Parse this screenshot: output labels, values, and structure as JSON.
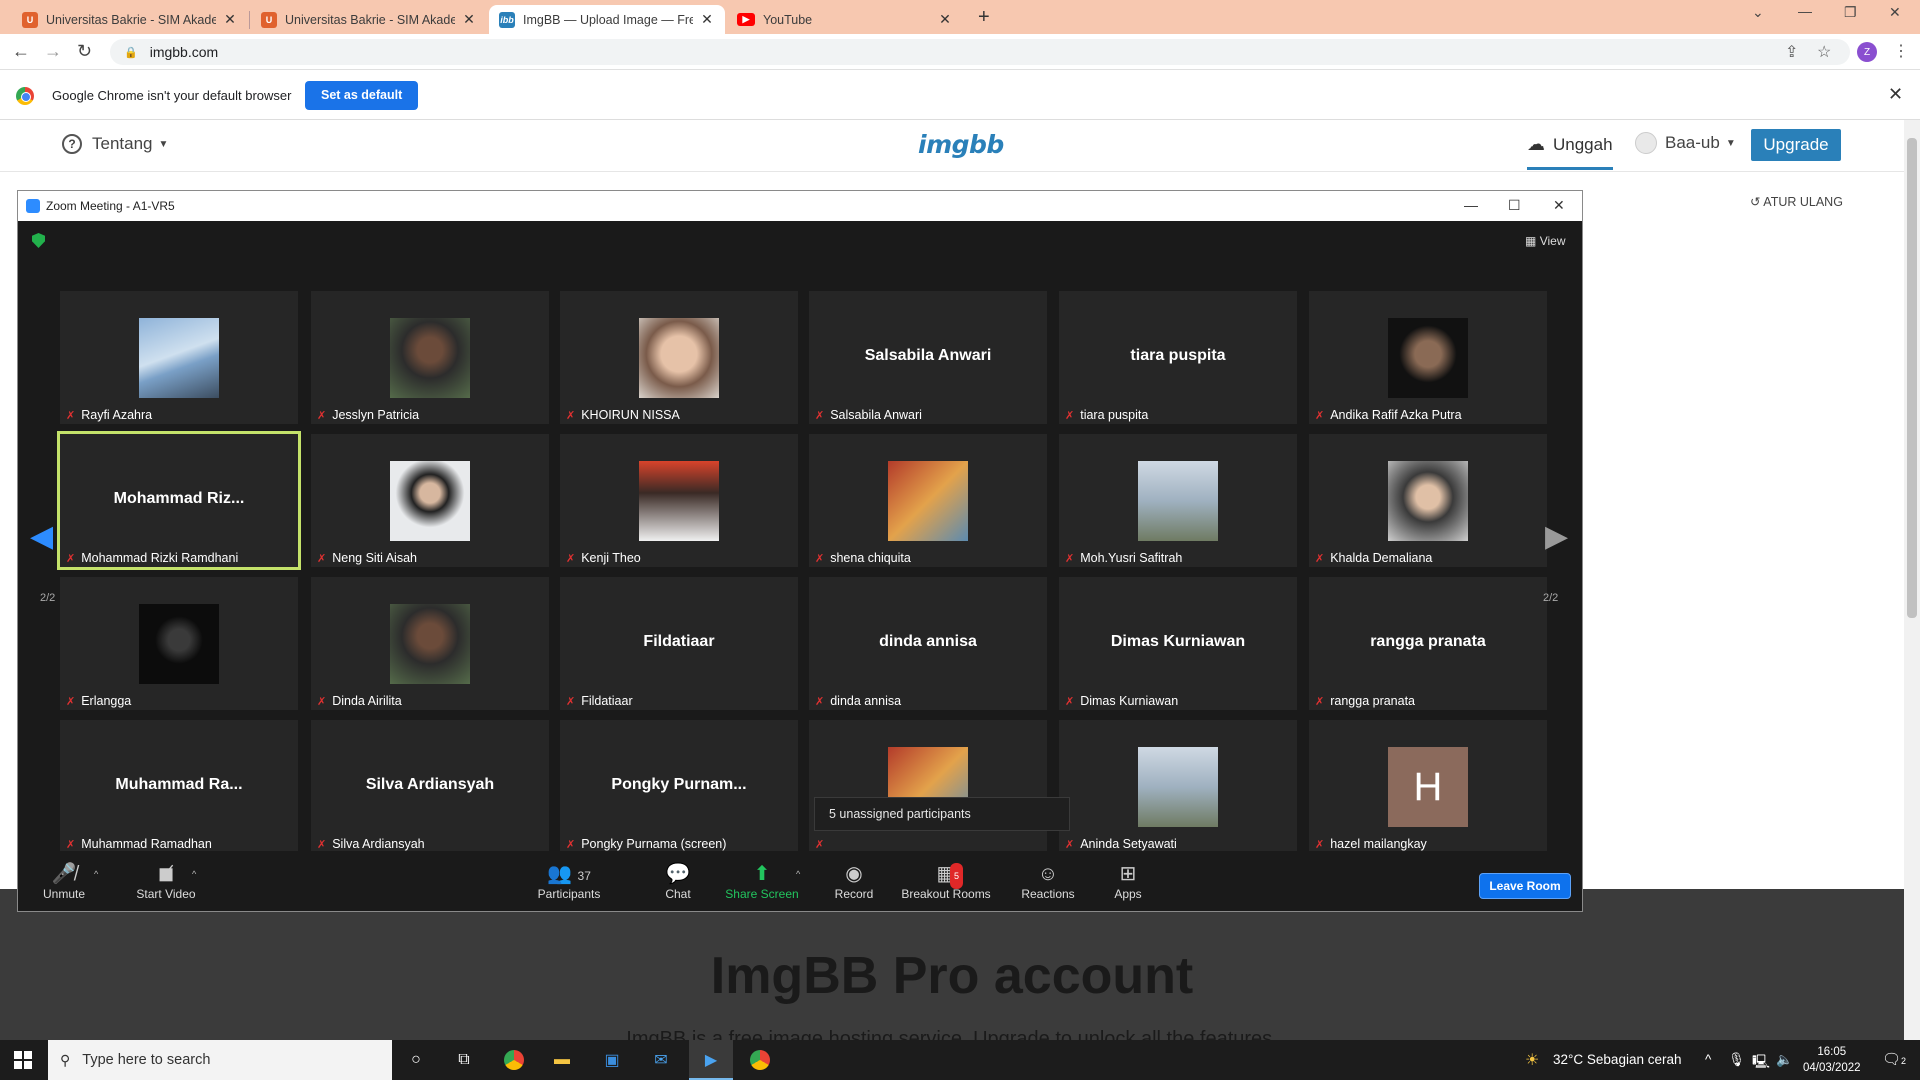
{
  "browser": {
    "tabs": [
      {
        "title": "Universitas Bakrie - SIM Akadem",
        "active": false
      },
      {
        "title": "Universitas Bakrie - SIM Akadem",
        "active": false
      },
      {
        "title": "ImgBB — Upload Image — Free I",
        "active": true
      },
      {
        "title": "YouTube",
        "active": false
      }
    ],
    "url": "imgbb.com",
    "profile_initial": "Z"
  },
  "infobar": {
    "message": "Google Chrome isn't your default browser",
    "button": "Set as default"
  },
  "imgbb": {
    "about": "Tentang",
    "logo": "imgbb",
    "upload": "Unggah",
    "user": "Baa-ub",
    "upgrade": "Upgrade",
    "reset": "ATUR ULANG",
    "pro_title": "ImgBB Pro account",
    "pro_sub": "ImgBB is a free image hosting service. Upgrade to unlock all the features."
  },
  "zoom": {
    "title": "Zoom Meeting - A1-VR5",
    "view": "View",
    "page_left": "2/2",
    "page_right": "2/2",
    "tooltip": "5 unassigned participants",
    "participants": [
      {
        "name": "Rayfi Azahra",
        "big": "",
        "pic": "sky"
      },
      {
        "name": "Jesslyn Patricia",
        "big": "",
        "pic": "photo"
      },
      {
        "name": "KHOIRUN NISSA",
        "big": "",
        "pic": "face"
      },
      {
        "name": "Salsabila Anwari",
        "big": "Salsabila Anwari",
        "pic": ""
      },
      {
        "name": "tiara puspita",
        "big": "tiara puspita",
        "pic": ""
      },
      {
        "name": "Andika Rafif Azka Putra",
        "big": "",
        "pic": "dark"
      },
      {
        "name": "Mohammad Rizki Ramdhani",
        "big": "Mohammad  Riz...",
        "pic": ""
      },
      {
        "name": "Neng Siti Aisah",
        "big": "",
        "pic": "light"
      },
      {
        "name": "Kenji Theo",
        "big": "",
        "pic": "red"
      },
      {
        "name": "shena chiquita",
        "big": "",
        "pic": "group"
      },
      {
        "name": "Moh.Yusri Safitrah",
        "big": "",
        "pic": "lake"
      },
      {
        "name": "Khalda Demaliana",
        "big": "",
        "pic": "hijab"
      },
      {
        "name": "Erlangga",
        "big": "",
        "pic": "black"
      },
      {
        "name": "Dinda Airilita",
        "big": "",
        "pic": "photo"
      },
      {
        "name": "Fildatiaar",
        "big": "Fildatiaar",
        "pic": ""
      },
      {
        "name": "dinda annisa",
        "big": "dinda annisa",
        "pic": ""
      },
      {
        "name": "Dimas Kurniawan",
        "big": "Dimas Kurniawan",
        "pic": ""
      },
      {
        "name": "rangga pranata",
        "big": "rangga pranata",
        "pic": ""
      },
      {
        "name": "Muhammad Ramadhan",
        "big": "Muhammad  Ra...",
        "pic": ""
      },
      {
        "name": "Silva Ardiansyah",
        "big": "Silva Ardiansyah",
        "pic": ""
      },
      {
        "name": "Pongky Purnama (screen)",
        "big": "Pongky  Purnam...",
        "pic": ""
      },
      {
        "name": "",
        "big": "",
        "pic": "group"
      },
      {
        "name": "Aninda Setyawati",
        "big": "",
        "pic": "lake"
      },
      {
        "name": "hazel mailangkay",
        "big": "",
        "pic": "letter",
        "letter": "H"
      }
    ],
    "toolbar": {
      "unmute": "Unmute",
      "start_video": "Start Video",
      "participants": "Participants",
      "participant_count": "37",
      "chat": "Chat",
      "share": "Share Screen",
      "record": "Record",
      "breakout": "Breakout Rooms",
      "breakout_badge": "5",
      "reactions": "Reactions",
      "apps": "Apps",
      "leave": "Leave Room"
    }
  },
  "taskbar": {
    "search_placeholder": "Type here to search",
    "weather": "32°C  Sebagian cerah",
    "time": "16:05",
    "date": "04/03/2022",
    "notif_count": "2"
  }
}
